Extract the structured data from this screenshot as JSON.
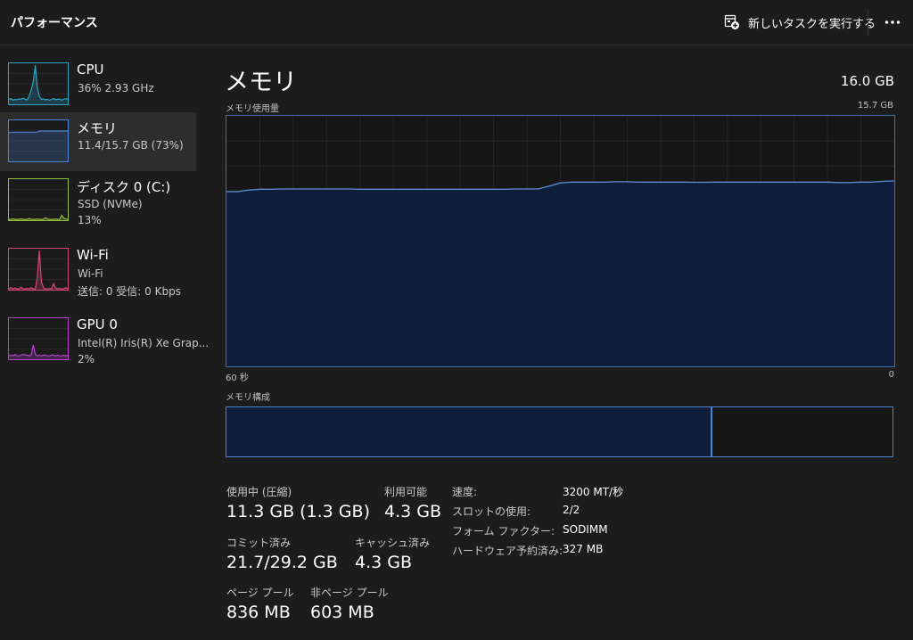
{
  "header": {
    "title": "パフォーマンス",
    "run_task_label": "新しいタスクを実行する",
    "run_task_icon": "new-task-icon",
    "more_icon": "more-dots-icon"
  },
  "sidebar": {
    "items": [
      {
        "title": "CPU",
        "sub1": "36%  2.93 GHz",
        "sub2": "",
        "color": "#2ba5c7",
        "series": [
          0.12,
          0.14,
          0.1,
          0.12,
          0.11,
          0.13,
          0.12,
          0.15,
          0.12,
          0.11,
          0.2,
          0.35,
          0.55,
          0.95,
          0.4,
          0.2,
          0.12,
          0.13,
          0.11,
          0.12,
          0.1,
          0.12,
          0.14,
          0.11,
          0.12,
          0.13,
          0.1,
          0.12,
          0.14,
          0.12
        ]
      },
      {
        "title": "メモリ",
        "sub1": "11.4/15.7 GB (73%)",
        "sub2": "",
        "color": "#4a86d8",
        "series": [
          0.7,
          0.71,
          0.71,
          0.71,
          0.71,
          0.71,
          0.71,
          0.71,
          0.71,
          0.71,
          0.71,
          0.71,
          0.71,
          0.71,
          0.71,
          0.74,
          0.74,
          0.74,
          0.74,
          0.74,
          0.74,
          0.74,
          0.74,
          0.74,
          0.74,
          0.74,
          0.74,
          0.74,
          0.74,
          0.74
        ]
      },
      {
        "title": "ディスク 0 (C:)",
        "sub1": "SSD (NVMe)",
        "sub2": "13%",
        "color": "#8fbf3a",
        "series": [
          0.02,
          0.02,
          0.03,
          0.02,
          0.02,
          0.02,
          0.03,
          0.02,
          0.02,
          0.02,
          0.04,
          0.02,
          0.02,
          0.02,
          0.03,
          0.02,
          0.02,
          0.02,
          0.06,
          0.03,
          0.02,
          0.02,
          0.02,
          0.03,
          0.02,
          0.02,
          0.12,
          0.05,
          0.03,
          0.02
        ]
      },
      {
        "title": "Wi-Fi",
        "sub1": "Wi-Fi",
        "sub2": "送信: 0  受信: 0 Kbps",
        "color": "#d9457a",
        "series": [
          0.02,
          0.05,
          0.02,
          0.04,
          0.02,
          0.02,
          0.06,
          0.02,
          0.02,
          0.03,
          0.02,
          0.05,
          0.02,
          0.02,
          0.3,
          0.95,
          0.2,
          0.05,
          0.02,
          0.02,
          0.03,
          0.02,
          0.15,
          0.04,
          0.02,
          0.03,
          0.02,
          0.02,
          0.05,
          0.02
        ]
      },
      {
        "title": "GPU 0",
        "sub1": "Intel(R) Iris(R) Xe Grap...",
        "sub2": "2%",
        "color": "#b443c9",
        "series": [
          0.08,
          0.1,
          0.08,
          0.12,
          0.08,
          0.08,
          0.1,
          0.12,
          0.1,
          0.1,
          0.08,
          0.1,
          0.35,
          0.12,
          0.08,
          0.1,
          0.08,
          0.1,
          0.1,
          0.08,
          0.08,
          0.1,
          0.1,
          0.08,
          0.1,
          0.08,
          0.08,
          0.1,
          0.08,
          0.1
        ]
      }
    ]
  },
  "main": {
    "title": "メモリ",
    "total": "16.0 GB",
    "usage_label": "メモリ使用量",
    "usage_max": "15.7 GB",
    "x_left": "60 秒",
    "x_right": "0",
    "composition_label": "メモリ構成",
    "composition_used_fraction": 0.727
  },
  "chart_data": {
    "type": "area",
    "title": "メモリ使用量",
    "ylim": [
      0,
      15.7
    ],
    "x": [
      60,
      59,
      58,
      57,
      56,
      55,
      54,
      53,
      52,
      51,
      50,
      49,
      48,
      47,
      46,
      45,
      44,
      43,
      42,
      41,
      40,
      39,
      38,
      37,
      36,
      35,
      34,
      33,
      32,
      31,
      30,
      29,
      28,
      27,
      26,
      25,
      24,
      23,
      22,
      21,
      20,
      19,
      18,
      17,
      16,
      15,
      14,
      13,
      12,
      11,
      10,
      9,
      8,
      7,
      6,
      5,
      4,
      3,
      2,
      1,
      0
    ],
    "series": [
      {
        "values": [
          10.95,
          10.95,
          11.05,
          11.1,
          11.1,
          11.12,
          11.12,
          11.12,
          11.12,
          11.12,
          11.12,
          11.12,
          11.1,
          11.1,
          11.1,
          11.1,
          11.1,
          11.1,
          11.1,
          11.1,
          11.1,
          11.1,
          11.1,
          11.1,
          11.1,
          11.1,
          11.12,
          11.12,
          11.12,
          11.3,
          11.5,
          11.55,
          11.55,
          11.55,
          11.55,
          11.57,
          11.57,
          11.55,
          11.55,
          11.55,
          11.55,
          11.55,
          11.54,
          11.54,
          11.55,
          11.55,
          11.55,
          11.55,
          11.55,
          11.55,
          11.55,
          11.55,
          11.55,
          11.55,
          11.55,
          11.52,
          11.52,
          11.55,
          11.55,
          11.6,
          11.62
        ]
      }
    ],
    "grid": true
  },
  "stats": {
    "in_use_label": "使用中 (圧縮)",
    "in_use_value": "11.3 GB (1.3 GB)",
    "available_label": "利用可能",
    "available_value": "4.3 GB",
    "committed_label": "コミット済み",
    "committed_value": "21.7/29.2 GB",
    "cached_label": "キャッシュ済み",
    "cached_value": "4.3 GB",
    "paged_label": "ページ プール",
    "paged_value": "836 MB",
    "nonpaged_label": "非ページ プール",
    "nonpaged_value": "603 MB"
  },
  "specs": [
    {
      "label": "速度:",
      "value": "3200 MT/秒"
    },
    {
      "label": "スロットの使用:",
      "value": "2/2"
    },
    {
      "label": "フォーム ファクター:",
      "value": "SODIMM"
    },
    {
      "label": "ハードウェア予約済み:",
      "value": "327 MB"
    }
  ]
}
